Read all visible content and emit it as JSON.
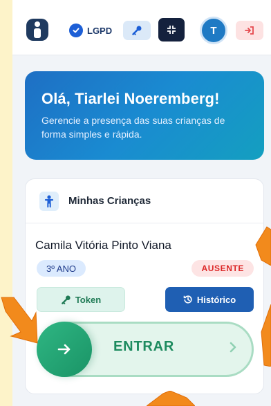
{
  "topbar": {
    "lgpd_label": "LGPD",
    "avatar_initial": "T"
  },
  "hero": {
    "greeting": "Olá, Tiarlei Noeremberg!",
    "subtitle": "Gerencie a presença das suas crianças de forma simples e rápida."
  },
  "card": {
    "title": "Minhas Crianças",
    "child": {
      "name": "Camila Vitória Pinto Viana",
      "grade": "3º ANO",
      "status": "AUSENTE"
    },
    "token_label": "Token",
    "history_label": "Histórico",
    "enter_label": "ENTRAR"
  },
  "colors": {
    "app_bg": "#f1f4f8",
    "page_bg": "#fdf3c9",
    "hero_start": "#1e6fc4",
    "hero_end": "#149fc0",
    "primary_blue": "#1f5fb3",
    "success_green": "#1d8b5f",
    "danger_red": "#dc2626",
    "hint_orange": "#f28a1c"
  },
  "icons": {
    "logo": "info-icon",
    "lgpd": "shield-check-icon",
    "key": "key-icon",
    "compress": "compress-icon",
    "logout": "logout-icon",
    "child": "child-icon",
    "token": "key-icon",
    "history": "history-icon",
    "enter": "arrow-right-icon",
    "chevron": "chevron-right-icon"
  }
}
